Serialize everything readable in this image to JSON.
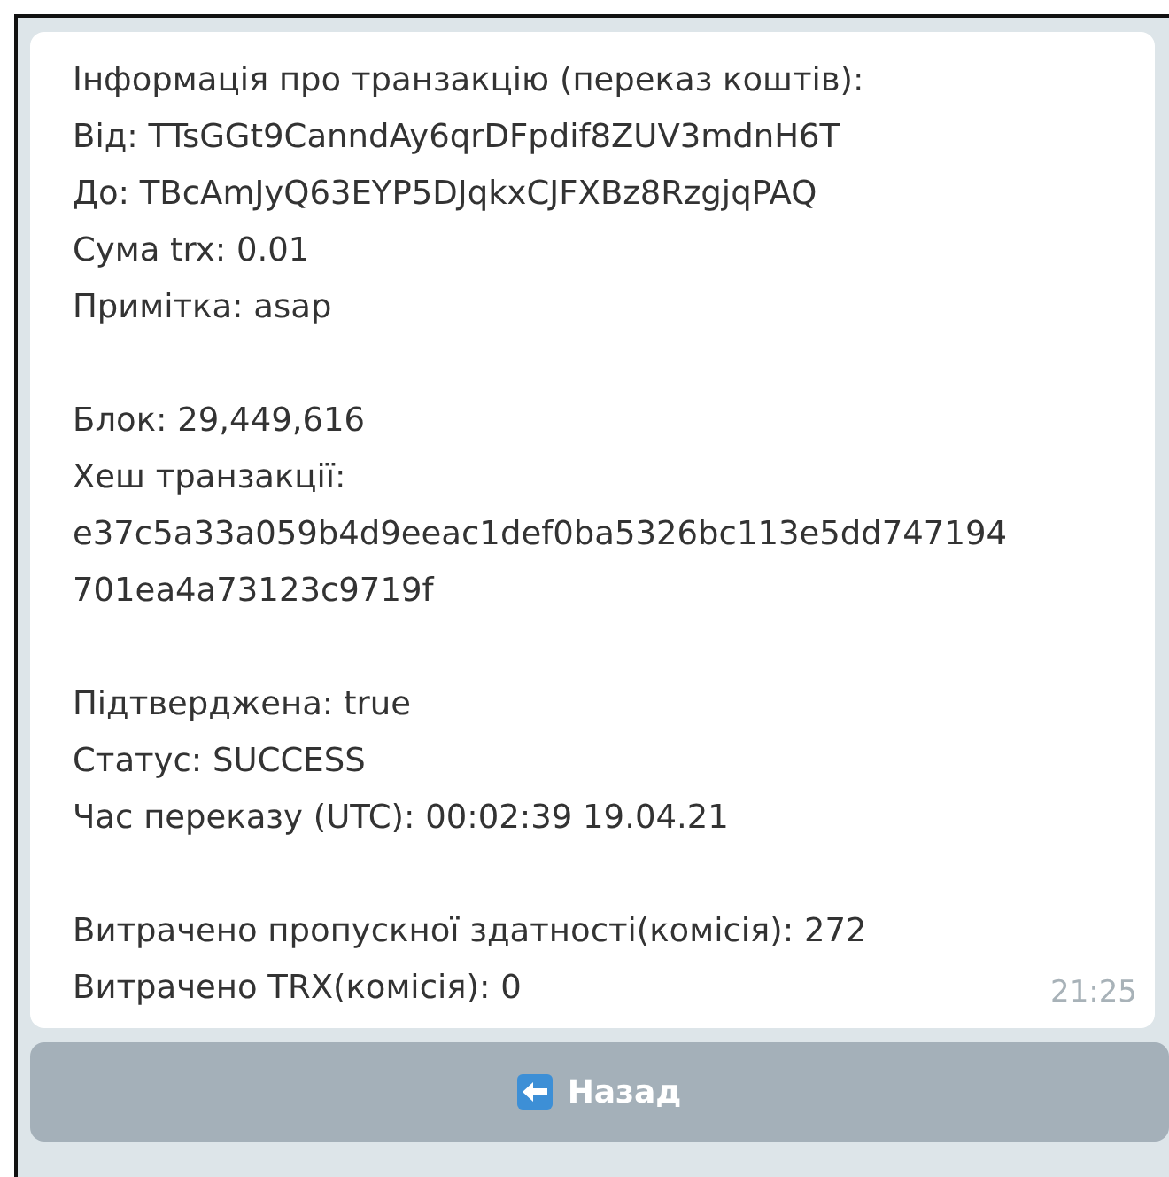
{
  "message": {
    "paragraphs": [
      [
        "Інформація про транзакцію (переказ коштів):",
        "Від: TTsGGt9CanndAy6qrDFpdif8ZUV3mdnH6T",
        "До: TBcAmJyQ63EYP5DJqkxCJFXBz8RzgjqPAQ",
        "Сума trx: 0.01",
        "Примітка: asap"
      ],
      [
        "Блок: 29,449,616",
        "Хеш транзакції:",
        "e37c5a33a059b4d9eeac1def0ba5326bc113e5dd747194",
        "701ea4a73123c9719f"
      ],
      [
        "Підтверджена: true",
        "Статус: SUCCESS",
        "Час переказу (UTC): 00:02:39 19.04.21"
      ],
      [
        "Витрачено пропускної здатності(комісія): 272",
        "Витрачено TRX(комісія): 0"
      ]
    ],
    "time": "21:25"
  },
  "buttons": [
    {
      "label": "Назад"
    }
  ]
}
